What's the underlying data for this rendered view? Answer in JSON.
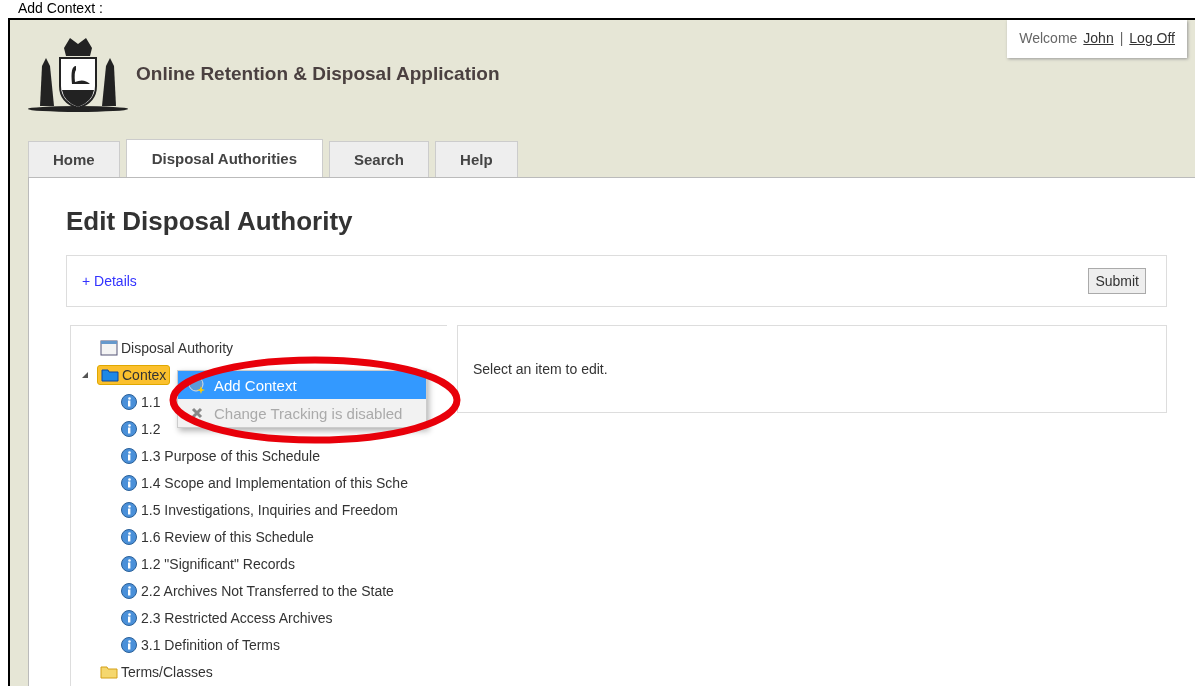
{
  "caption": "Add Context :",
  "header": {
    "title": "Online Retention & Disposal Application",
    "greeting": "Welcome",
    "user_name": "John",
    "separator": "|",
    "logoff": "Log Off"
  },
  "tabs": [
    {
      "label": "Home",
      "selected": false
    },
    {
      "label": "Disposal Authorities",
      "selected": true
    },
    {
      "label": "Search",
      "selected": false
    },
    {
      "label": "Help",
      "selected": false
    }
  ],
  "page": {
    "title": "Edit Disposal Authority",
    "details_link": "+ Details",
    "submit": "Submit"
  },
  "tree": [
    {
      "label": "Disposal Authority",
      "kind": "document",
      "selected": false
    },
    {
      "label": "Contex",
      "kind": "folder",
      "selected": true,
      "expanded": true,
      "children": [
        {
          "label": "1.1",
          "kind": "info",
          "selected": false
        },
        {
          "label": "1.2",
          "kind": "info",
          "selected": false
        },
        {
          "label": "1.3 Purpose of this Schedule",
          "kind": "info",
          "selected": false
        },
        {
          "label": "1.4 Scope and Implementation of this Sche",
          "kind": "info",
          "selected": false
        },
        {
          "label": "1.5 Investigations, Inquiries and Freedom",
          "kind": "info",
          "selected": false
        },
        {
          "label": "1.6 Review of this Schedule",
          "kind": "info",
          "selected": false
        },
        {
          "label": "1.2 \"Significant\" Records",
          "kind": "info",
          "selected": false
        },
        {
          "label": "2.2 Archives Not Transferred to the State",
          "kind": "info",
          "selected": false
        },
        {
          "label": "2.3 Restricted Access Archives",
          "kind": "info",
          "selected": false
        },
        {
          "label": "3.1 Definition of Terms",
          "kind": "info",
          "selected": false
        }
      ]
    },
    {
      "label": "Terms/Classes",
      "kind": "folder",
      "selected": false
    }
  ],
  "context_menu": [
    {
      "label": "Add Context",
      "kind": "add",
      "selected": true,
      "disabled": false
    },
    {
      "label": "Change Tracking is disabled",
      "kind": "cross",
      "selected": false,
      "disabled": true
    }
  ],
  "editor": {
    "message": "Select an item to edit."
  }
}
